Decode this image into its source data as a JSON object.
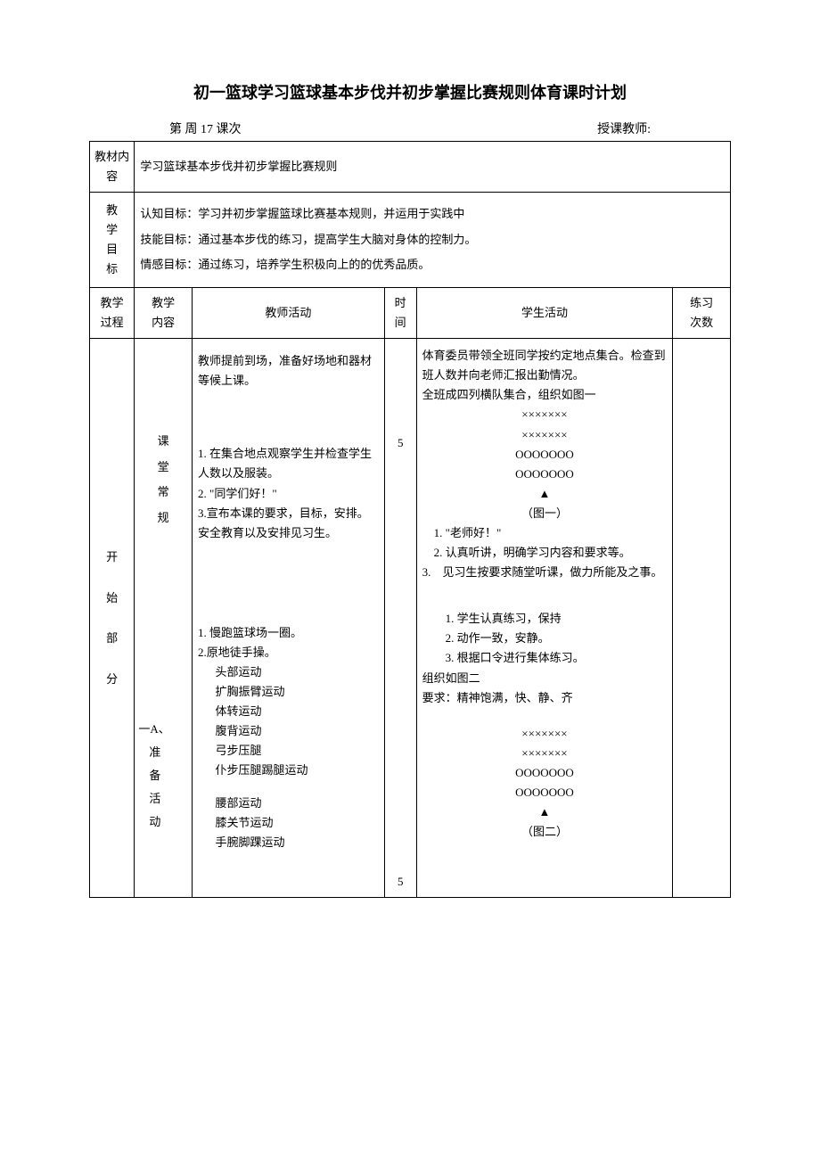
{
  "title": "初一篮球学习篮球基本步伐并初步掌握比赛规则体育课时计划",
  "header": {
    "week_label": "第 周 17 课次",
    "teacher_label": "授课教师:"
  },
  "row_material": {
    "label_l1": "教材内",
    "label_l2": "容",
    "value": "学习篮球基本步伐并初步掌握比赛规则"
  },
  "row_goals": {
    "label_l1": "教",
    "label_l2": "学",
    "label_l3": "目",
    "label_l4": "标",
    "cog": "认知目标：学习并初步掌握篮球比赛基本规则，并运用于实践中",
    "skill": "技能目标：通过基本步伐的练习，提高学生大脑对身体的控制力。",
    "affect": "情感目标：通过练习，培养学生积极向上的的优秀品质。"
  },
  "columns": {
    "proc": "教学\n过程",
    "content": "教学\n内容",
    "teacher": "教师活动",
    "time": "时\n间",
    "student": "学生活动",
    "reps": "练习\n次数"
  },
  "start_section": {
    "proc_l1": "开",
    "proc_l2": "始",
    "proc_l3": "部",
    "proc_l4": "分",
    "content1_l1": "课",
    "content1_l2": "堂",
    "content1_l3": "常",
    "content1_l4": "规",
    "content2_l0": "一A、",
    "content2_l1": "准",
    "content2_l2": "备",
    "content2_l3": "活",
    "content2_l4": "动",
    "teacher_block1_p1": "教师提前到场，准备好场地和器材等候上课。",
    "teacher_block1_i1": "1. 在集合地点观察学生并检查学生人数以及服装。",
    "teacher_block1_i2": "2. \"同学们好！\"",
    "teacher_block1_i3": "3.宣布本课的要求，目标，安排。",
    "teacher_block1_i4": "安全教育以及安排见习生。",
    "teacher_block2_i1": "1. 慢跑篮球场一圈。",
    "teacher_block2_i2": "2.原地徒手操。",
    "teacher_block2_l1": "头部运动",
    "teacher_block2_l2": "扩胸振臂运动",
    "teacher_block2_l3": "体转运动",
    "teacher_block2_l4": "腹背运动",
    "teacher_block2_l5": "弓步压腿",
    "teacher_block2_l6": "仆步压腿踢腿运动",
    "teacher_block2_l7": "腰部运动",
    "teacher_block2_l8": "膝关节运动",
    "teacher_block2_l9": "手腕脚踝运动",
    "time1": "5",
    "time2": "5",
    "stu_p1": "体育委员带领全班同学按约定地点集合。检查到班人数并向老师汇报出勤情况。",
    "stu_p2": "全班成四列横队集合，组织如图一",
    "stu_d1_l1": "×××××××",
    "stu_d1_l2": "×××××××",
    "stu_d1_l3": "OOOOOOO",
    "stu_d1_l4": "OOOOOOO",
    "stu_d1_l5": "▲",
    "stu_d1_cap": "（图一）",
    "stu_i1": "1. \"老师好！\"",
    "stu_i2": "2. 认真听讲，明确学习内容和要求等。",
    "stu_i3": "3.　见习生按要求随堂听课，做力所能及之事。",
    "stu_b2_i1": "1. 学生认真练习，保持",
    "stu_b2_i2": "2. 动作一致，安静。",
    "stu_b2_i3": "3. 根据口令进行集体练习。",
    "stu_org": "组织如图二",
    "stu_req": "要求：精神饱满，快、静、齐",
    "stu_d2_l1": "×××××××",
    "stu_d2_l2": "×××××××",
    "stu_d2_l3": "OOOOOOO",
    "stu_d2_l4": "OOOOOOO",
    "stu_d2_l5": "▲",
    "stu_d2_cap": "（图二）"
  }
}
